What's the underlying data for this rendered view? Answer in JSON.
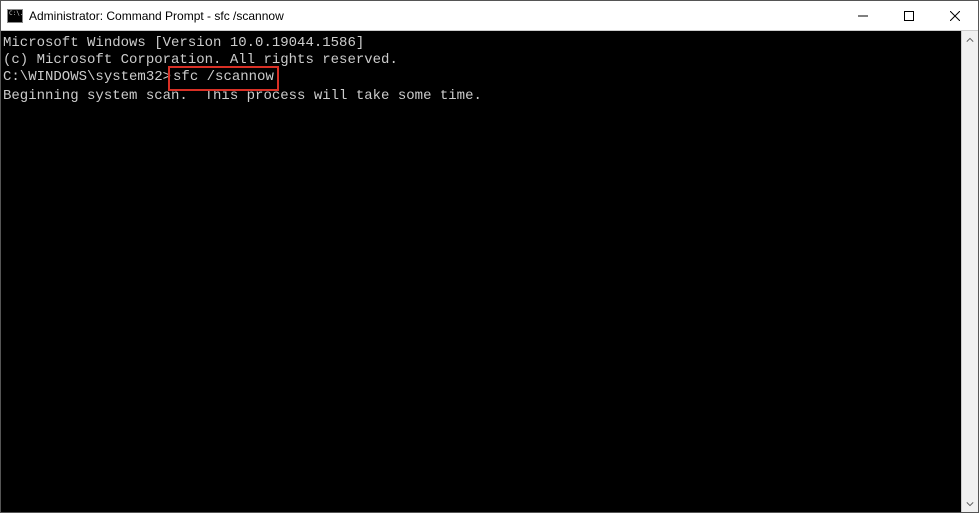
{
  "window": {
    "title": "Administrator: Command Prompt - sfc  /scannow",
    "icon_text": "C:\\."
  },
  "terminal": {
    "line1": "Microsoft Windows [Version 10.0.19044.1586]",
    "line2": "(c) Microsoft Corporation. All rights reserved.",
    "blank1": "",
    "prompt": "C:\\WINDOWS\\system32>",
    "command": "sfc /scannow",
    "blank2": "",
    "line3": "Beginning system scan.  This process will take some time.",
    "blank3": ""
  }
}
